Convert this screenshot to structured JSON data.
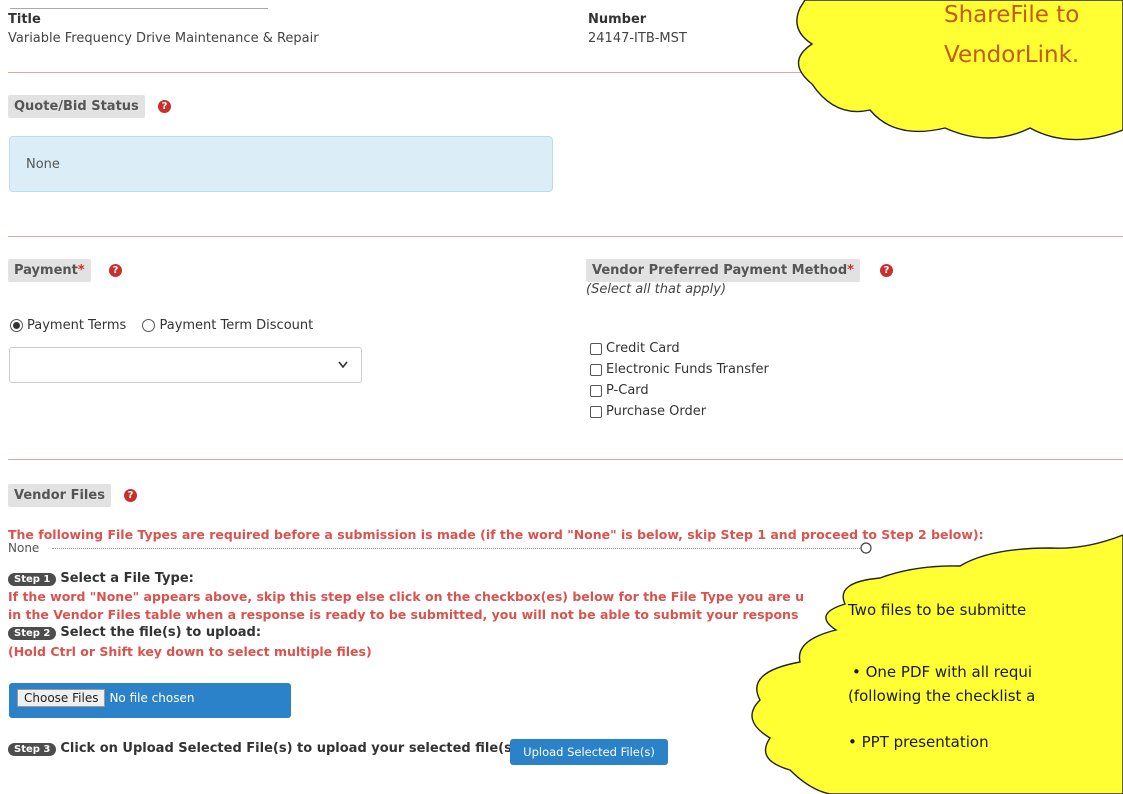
{
  "header": {
    "title_label": "Title",
    "title_value": "Variable Frequency Drive Maintenance & Repair",
    "number_label": "Number",
    "number_value": "24147-ITB-MST"
  },
  "quote_status": {
    "label": "Quote/Bid Status",
    "help_glyph": "?",
    "value": "None"
  },
  "payment": {
    "label": "Payment",
    "required_mark": "*",
    "help_glyph": "?",
    "radio_terms": "Payment Terms",
    "radio_discount": "Payment Term Discount",
    "selected_radio": "Payment Terms",
    "select_value": ""
  },
  "vendor_payment": {
    "label": "Vendor Preferred Payment Method",
    "required_mark": "*",
    "help_glyph": "?",
    "hint": "(Select all that apply)",
    "options": [
      "Credit Card",
      "Electronic Funds Transfer",
      "P-Card",
      "Purchase Order"
    ]
  },
  "vendor_files": {
    "label": "Vendor Files",
    "help_glyph": "?",
    "required_text": "The following File Types are required before a submission is made (if the word \"None\" is below, skip Step 1 and proceed to Step 2 below):",
    "required_value": "None",
    "step1_badge": "Step 1",
    "step1_title": "Select a File Type:",
    "step1_red_1": "If the word \"None\" appears above, skip this step else click on the checkbox(es) below for the File Type you are u",
    "step1_red_2": "in the Vendor Files table when a response is ready to be submitted, you will not be able to submit your respons",
    "step2_badge": "Step 2",
    "step2_title": "Select the file(s) to upload:",
    "step2_red": "(Hold Ctrl or Shift key down to select multiple files)",
    "choose_files": "Choose Files",
    "no_file": "No file chosen",
    "step3_badge": "Step 3",
    "step3_title": "Click on Upload Selected File(s) to upload your selected file(s):",
    "upload_button": "Upload Selected File(s)"
  },
  "callouts": {
    "top_line1": "ShareFile to",
    "top_line2": "VendorLink.",
    "bottom_line1": "Two files to be submitte",
    "bottom_line2": "• One PDF with all requi",
    "bottom_line3": "(following the checklist a",
    "bottom_line4": "• PPT presentation"
  },
  "colors": {
    "callout_fill": "#ffff33",
    "callout_text_top": "#c55a11",
    "accent_blue": "#2b82c9",
    "divider": "#e4a3a3",
    "required_red": "#c9302c"
  }
}
